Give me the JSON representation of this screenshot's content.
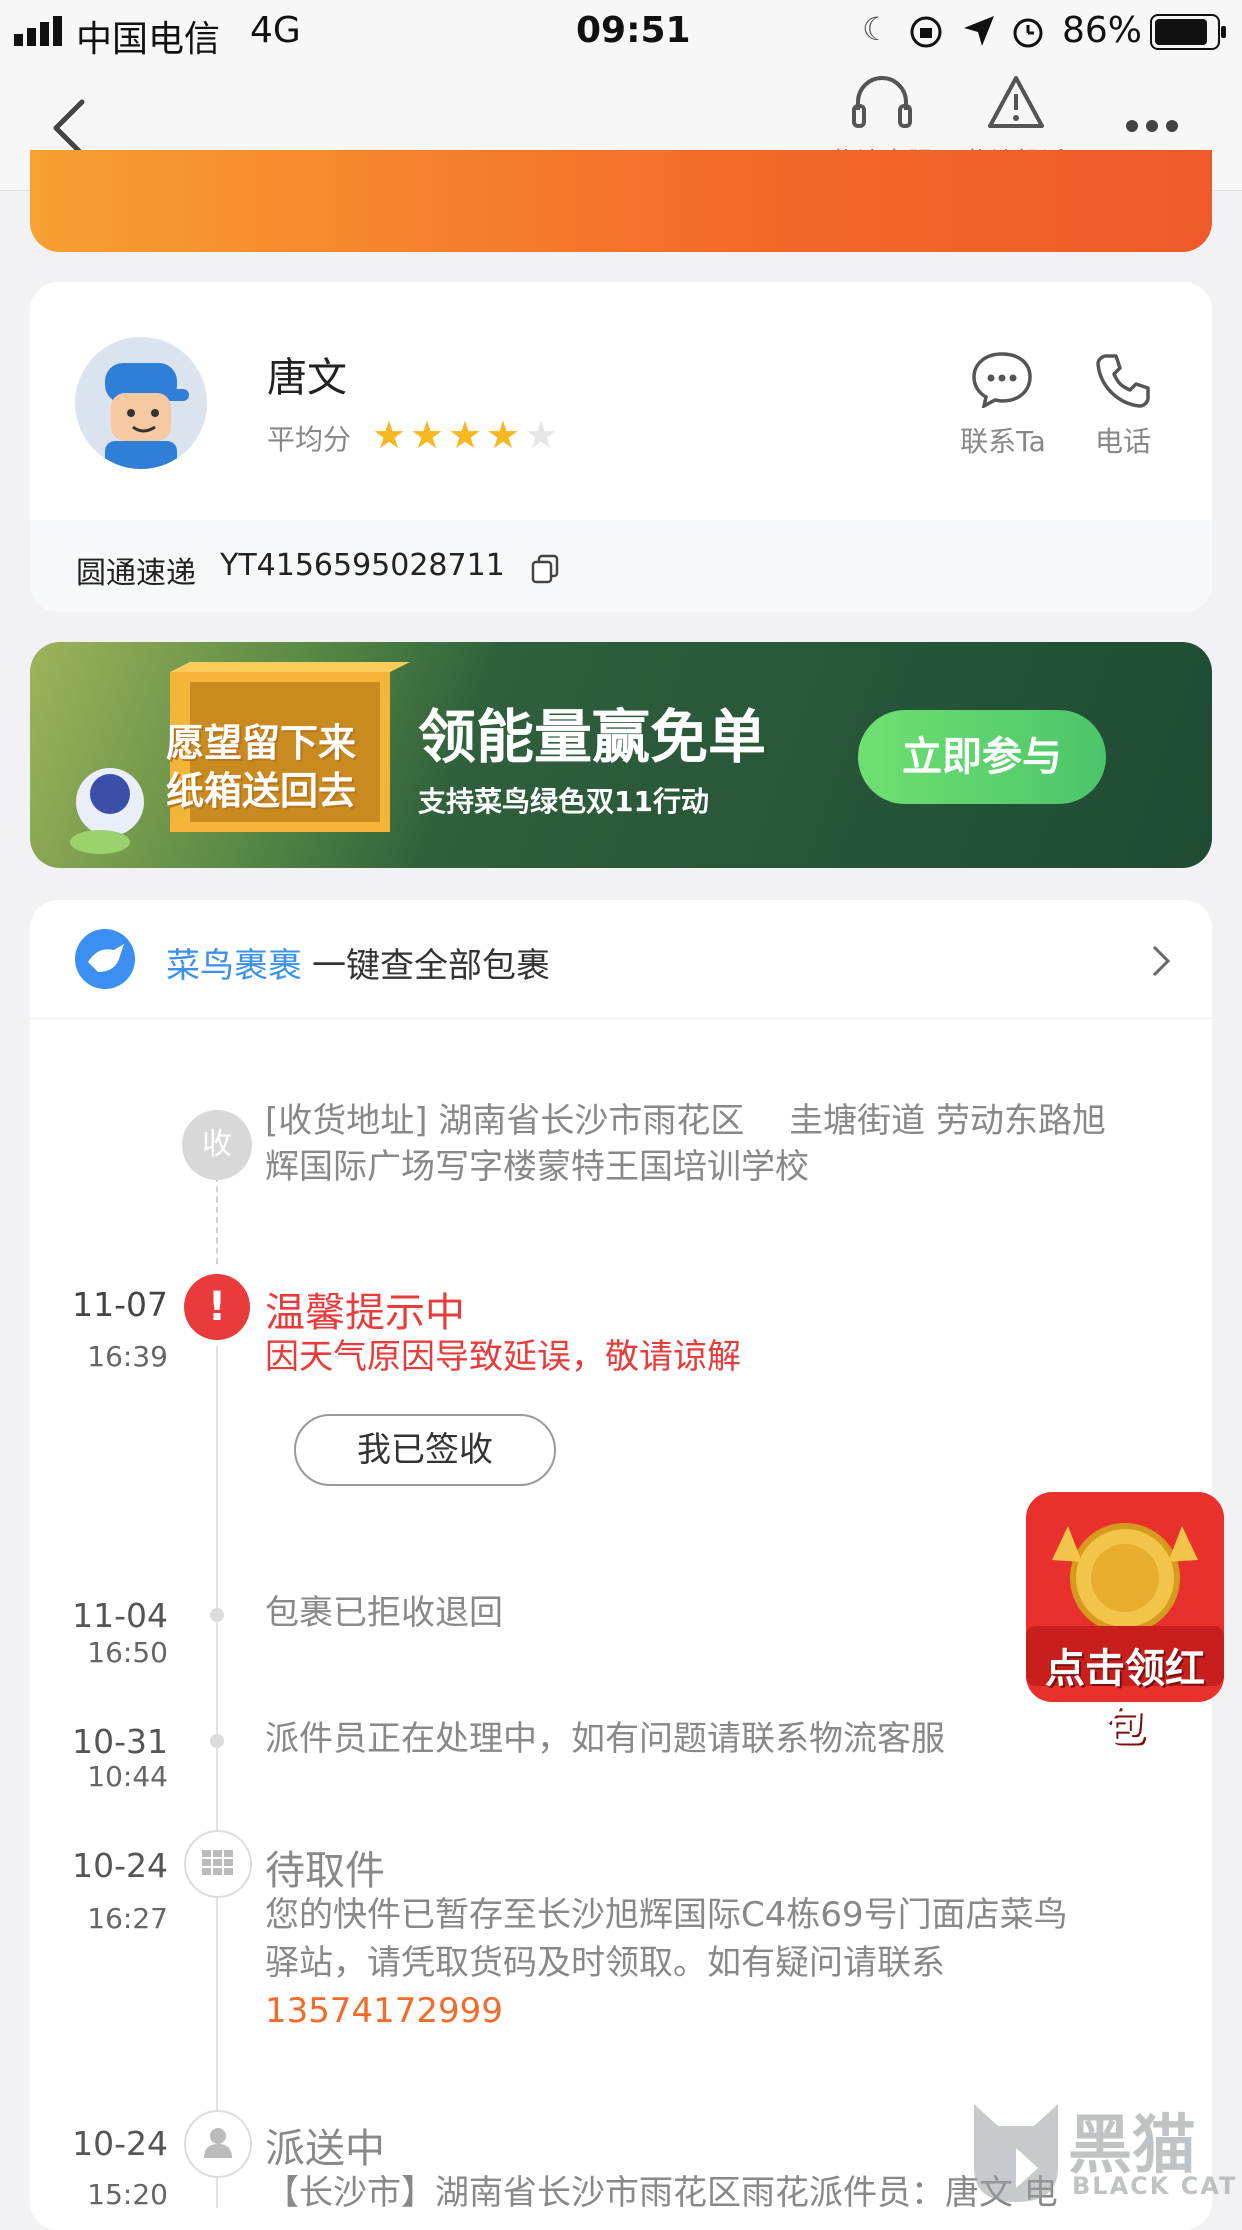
{
  "status_bar": {
    "carrier": "中国电信",
    "network": "4G",
    "time": "09:51",
    "battery": "86%"
  },
  "nav": {
    "service_label": "物流客服",
    "complaint_label": "物流投诉"
  },
  "courier": {
    "name": "唐文",
    "score_label": "平均分",
    "rating": 4,
    "rating_max": 5,
    "contact_label": "联系Ta",
    "phone_label": "电话",
    "company": "圆通速递",
    "tracking_no": "YT4156595028711"
  },
  "banner": {
    "box_text_1": "愿望留下来",
    "box_text_2": "纸箱送回去",
    "headline": "领能量赢免单",
    "sub": "支持菜鸟绿色双11行动",
    "button": "立即参与"
  },
  "cainiao": {
    "brand": "菜鸟裹裹",
    "text": "一键查全部包裹"
  },
  "timeline": {
    "address_badge": "收",
    "address_line1": "[收货地址] 湖南省长沙市雨花区　 圭塘街道 劳动东路旭",
    "address_line2": "辉国际广场写字楼蒙特王国培训学校",
    "events": [
      {
        "date": "11-07",
        "time": "16:39",
        "title": "温馨提示中",
        "desc": "因天气原因导致延误，敬请谅解"
      },
      {
        "date": "11-04",
        "time": "16:50",
        "desc": "包裹已拒收退回"
      },
      {
        "date": "10-31",
        "time": "10:44",
        "desc": "派件员正在处理中，如有问题请联系物流客服"
      },
      {
        "date": "10-24",
        "time": "16:27",
        "title": "待取件",
        "desc_line1": "您的快件已暂存至长沙旭辉国际C4栋69号门面店菜鸟",
        "desc_line2": "驿站，请凭取货码及时领取。如有疑问请联系",
        "phone": "13574172999"
      },
      {
        "date": "10-24",
        "time": "15:20",
        "title": "派送中",
        "desc": "【长沙市】湖南省长沙市雨花区雨花派件员：唐文 电"
      }
    ],
    "signed_button": "我已签收"
  },
  "red_packet": {
    "label": "点击领红包"
  },
  "watermark": {
    "cn": "黑猫",
    "en": "BLACK CAT"
  },
  "colors": {
    "accent_red": "#e93b3b",
    "accent_orange": "#f36a2a",
    "brand_blue": "#3a8ff0",
    "star": "#f8b621"
  }
}
